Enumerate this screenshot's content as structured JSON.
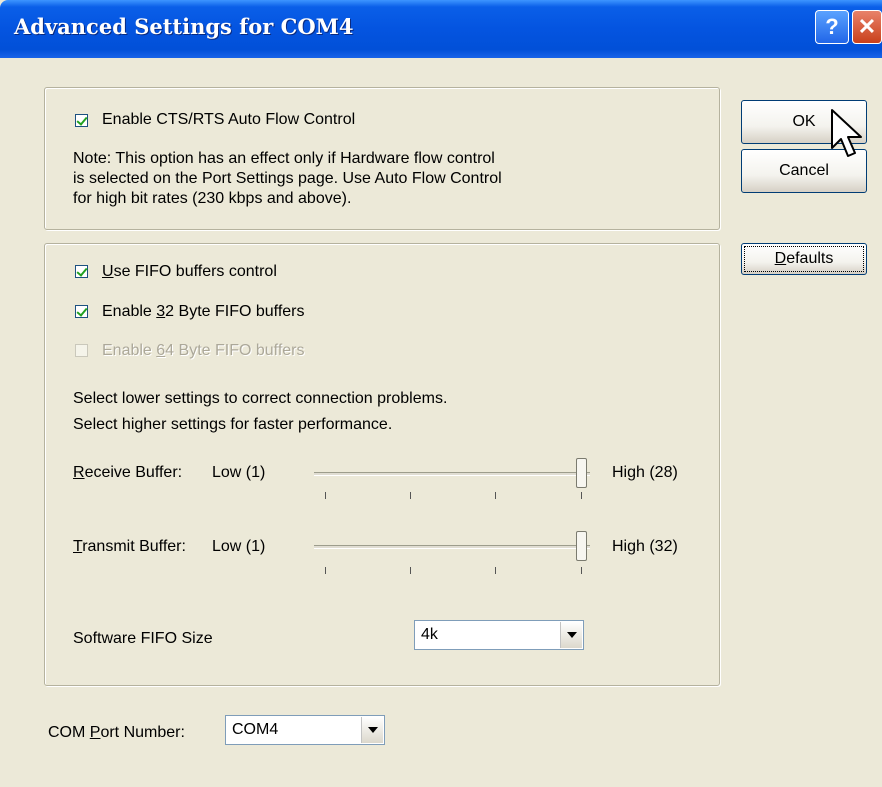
{
  "window": {
    "title": "Advanced Settings for COM4",
    "help_glyph": "?",
    "close_glyph": "✕"
  },
  "flow_control": {
    "checkbox_label": "Enable CTS/RTS Auto Flow Control",
    "checked": true,
    "note_lines": [
      "Note: This option has an effect only if Hardware flow control",
      "is selected on the Port Settings page. Use Auto Flow Control",
      "for high bit rates (230 kbps and above)."
    ]
  },
  "fifo": {
    "use_fifo": {
      "pre": "",
      "mnemonic": "U",
      "post": "se FIFO buffers control",
      "checked": true
    },
    "enable_32": {
      "pre": "Enable ",
      "mnemonic": "3",
      "post": "2 Byte FIFO buffers",
      "checked": true
    },
    "enable_64": {
      "pre": "Enable ",
      "mnemonic": "6",
      "post": "4 Byte FIFO buffers",
      "checked": false,
      "disabled": true
    },
    "hint_lines": [
      "Select lower settings to correct connection problems.",
      "Select higher settings for faster performance."
    ],
    "receive": {
      "label_mnemonic": "R",
      "label_rest": "eceive Buffer:",
      "low_label": "Low (1)",
      "high_label": "High (28)",
      "min": 1,
      "max": 28,
      "value": 28
    },
    "transmit": {
      "label_mnemonic": "T",
      "label_rest": "ransmit Buffer:",
      "low_label": "Low (1)",
      "high_label": "High (32)",
      "min": 1,
      "max": 32,
      "value": 32
    },
    "software_fifo": {
      "label": "Software FIFO Size",
      "value": "4k"
    }
  },
  "com_port": {
    "label_pre": "COM ",
    "label_mnemonic": "P",
    "label_post": "ort Number:",
    "value": "COM4"
  },
  "buttons": {
    "ok": "OK",
    "cancel": "Cancel",
    "defaults_mnemonic": "D",
    "defaults_rest": "efaults"
  },
  "colors": {
    "titlebar": "#0454e0",
    "dialog_bg": "#ece9d8",
    "button_border": "#003c74"
  }
}
